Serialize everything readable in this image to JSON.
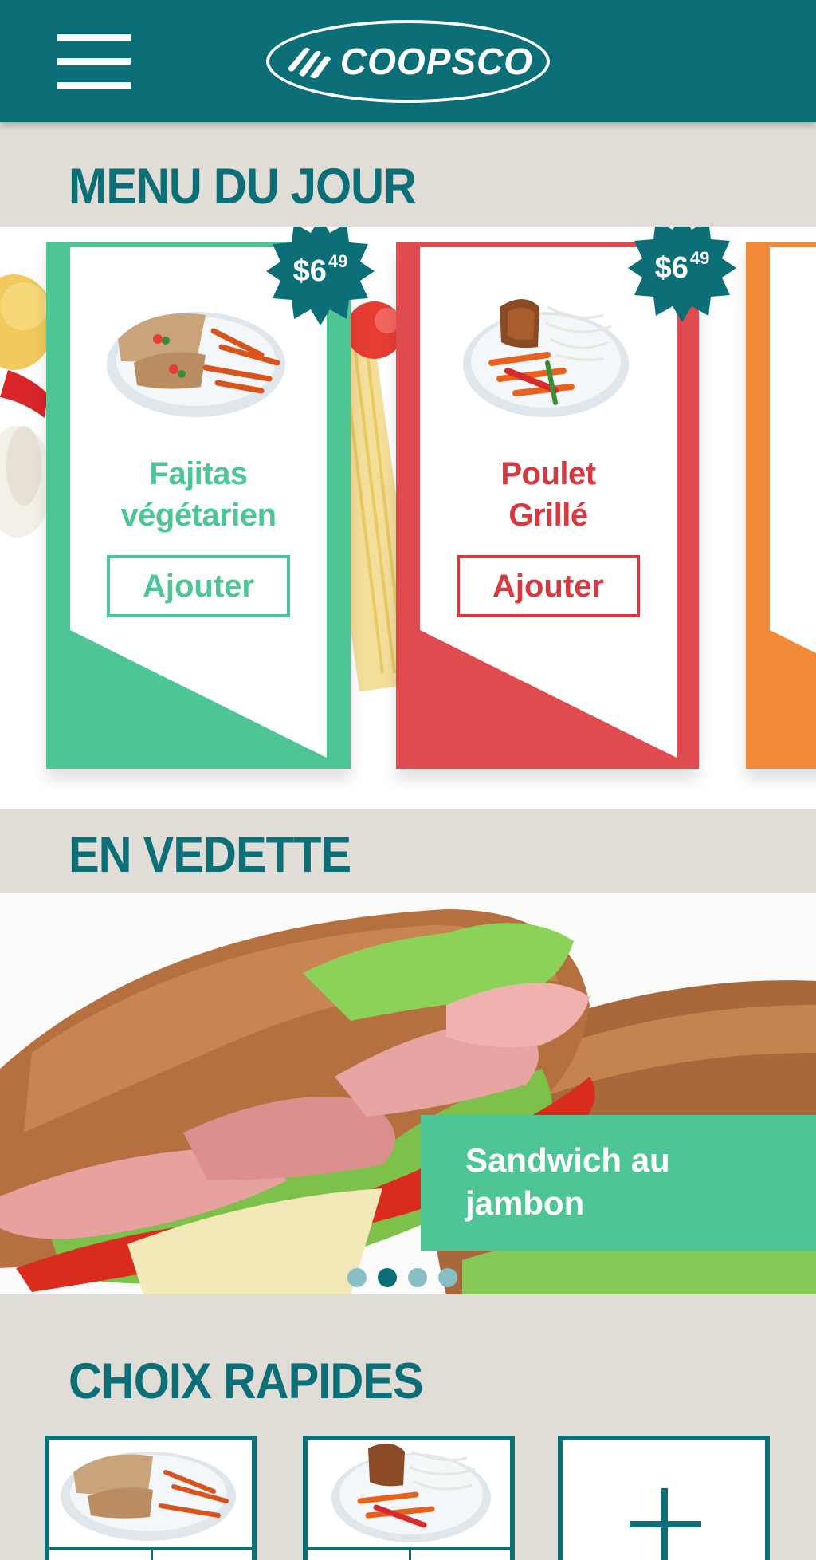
{
  "header": {
    "brand": "COOPSCO",
    "colors": {
      "bar": "#0c6f78"
    },
    "menu_icon": "hamburger-menu-icon"
  },
  "menu_du_jour": {
    "title": "MENU DU JOUR",
    "cards": [
      {
        "name_line1": "Fajitas",
        "name_line2": "végétarien",
        "price_main": "$6",
        "price_cents": "49",
        "button": "Ajouter",
        "color": "#4ec594",
        "text_color": "#4ec594"
      },
      {
        "name_line1": "Poulet",
        "name_line2": "Grillé",
        "price_main": "$6",
        "price_cents": "49",
        "button": "Ajouter",
        "color": "#e04b50",
        "text_color": "#d8393e"
      },
      {
        "color": "#f08a38"
      }
    ],
    "badge_color": "#0c6f78"
  },
  "en_vedette": {
    "title": "EN VEDETTE",
    "caption_line1": "Sandwich au",
    "caption_line2": "jambon",
    "slides": 4,
    "active_slide": 2
  },
  "choix_rapides": {
    "title": "CHOIX RAPIDES",
    "add_icon": "plus-icon"
  }
}
